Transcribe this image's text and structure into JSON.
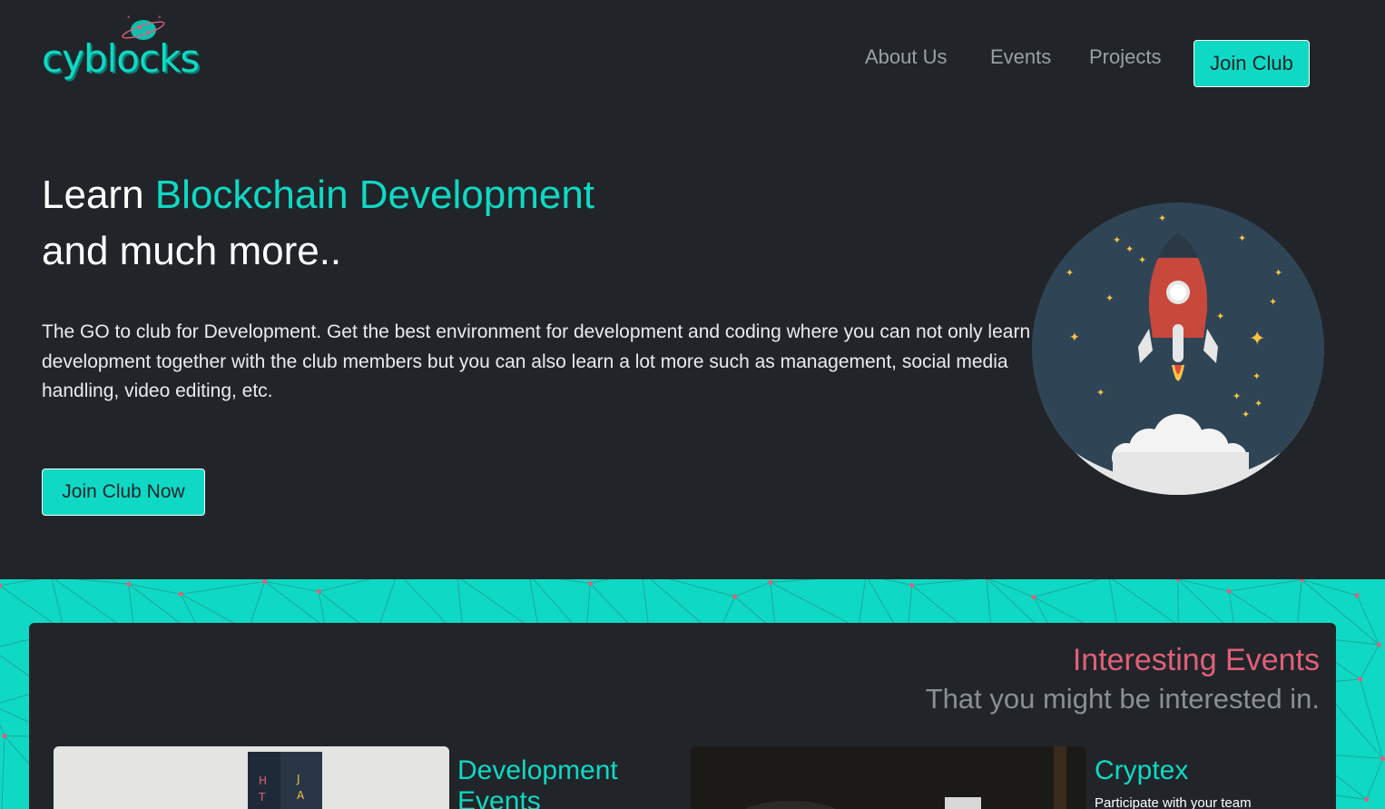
{
  "header": {
    "logo_text": "cyblocks",
    "nav": [
      {
        "label": "About Us"
      },
      {
        "label": "Events"
      },
      {
        "label": "Projects"
      }
    ],
    "join_button": "Join Club"
  },
  "hero": {
    "title_prefix": "Learn ",
    "title_accent": "Blockchain Development",
    "title_line2": "and much more..",
    "description": "The GO to club for Development. Get the best environment for development and coding where you can not only learn development together with the club members but you can also learn a lot more such as management, social media handling, video editing, etc.",
    "cta_button": "Join Club Now"
  },
  "events": {
    "title": "Interesting Events",
    "subtitle": "That you might be interested in.",
    "items": [
      {
        "name": "Development Events",
        "description": ""
      },
      {
        "name": "Cryptex",
        "description": "Participate with your team"
      }
    ]
  },
  "colors": {
    "background": "#212529",
    "accent": "#0fd9c4",
    "pink": "#e25f7a",
    "muted": "#8a8f95"
  }
}
